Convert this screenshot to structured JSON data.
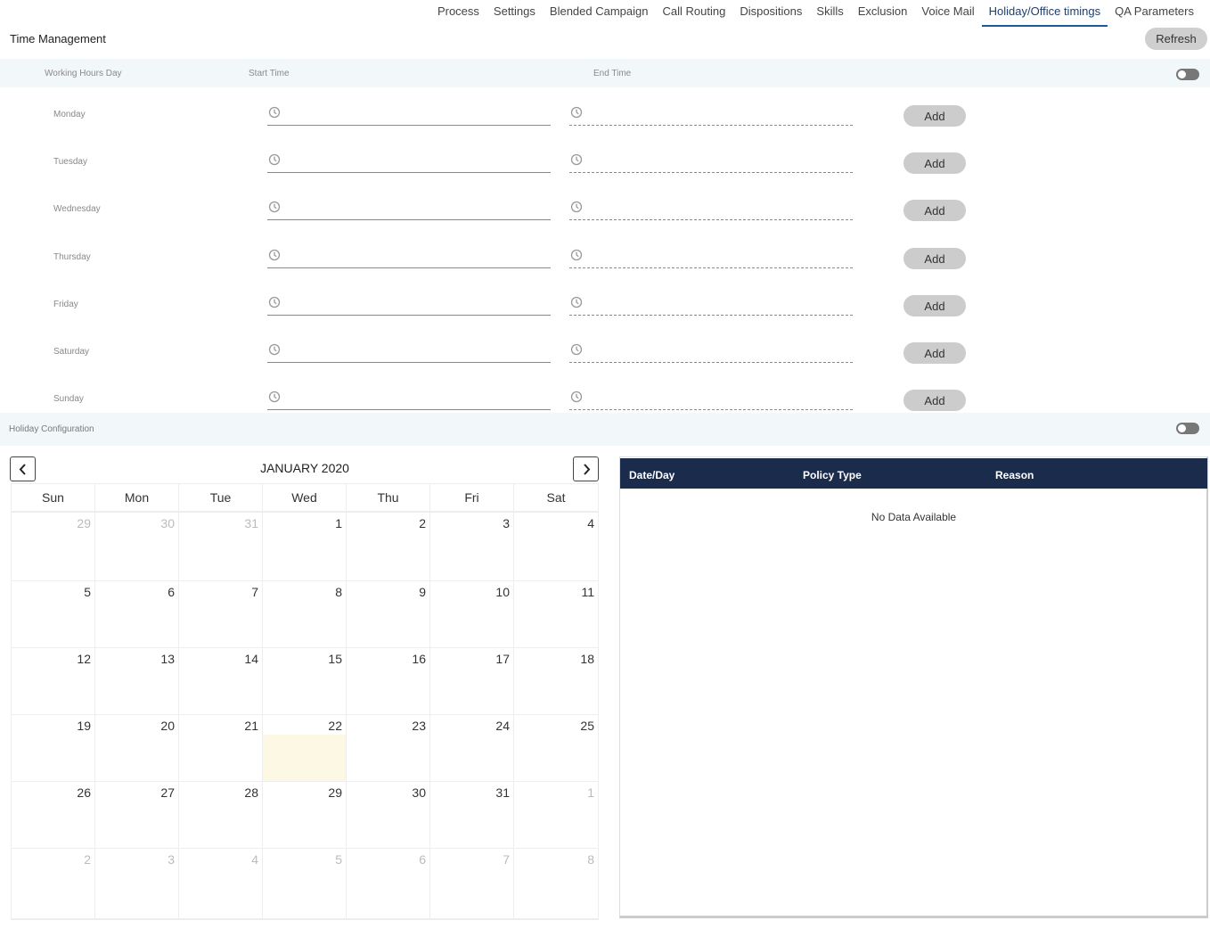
{
  "nav": {
    "tabs": [
      {
        "label": "Process",
        "active": false
      },
      {
        "label": "Settings",
        "active": false
      },
      {
        "label": "Blended Campaign",
        "active": false
      },
      {
        "label": "Call Routing",
        "active": false
      },
      {
        "label": "Dispositions",
        "active": false
      },
      {
        "label": "Skills",
        "active": false
      },
      {
        "label": "Exclusion",
        "active": false
      },
      {
        "label": "Voice Mail",
        "active": false
      },
      {
        "label": "Holiday/Office timings",
        "active": true
      },
      {
        "label": "QA Parameters",
        "active": false
      }
    ]
  },
  "header": {
    "title": "Time Management",
    "refresh_label": "Refresh"
  },
  "working_hours": {
    "col_day": "Working Hours Day",
    "col_start": "Start Time",
    "col_end": "End Time",
    "toggle_on": false,
    "add_label": "Add",
    "days": [
      {
        "name": "Monday",
        "start": "",
        "end": ""
      },
      {
        "name": "Tuesday",
        "start": "",
        "end": ""
      },
      {
        "name": "Wednesday",
        "start": "",
        "end": ""
      },
      {
        "name": "Thursday",
        "start": "",
        "end": ""
      },
      {
        "name": "Friday",
        "start": "",
        "end": ""
      },
      {
        "name": "Saturday",
        "start": "",
        "end": ""
      },
      {
        "name": "Sunday",
        "start": "",
        "end": ""
      }
    ]
  },
  "holiday": {
    "title": "Holiday Configuration",
    "toggle_on": false,
    "calendar": {
      "title": "JANUARY 2020",
      "weekdays": [
        "Sun",
        "Mon",
        "Tue",
        "Wed",
        "Thu",
        "Fri",
        "Sat"
      ],
      "today": 22,
      "weeks": [
        [
          {
            "d": "29",
            "m": true
          },
          {
            "d": "30",
            "m": true
          },
          {
            "d": "31",
            "m": true
          },
          {
            "d": "1"
          },
          {
            "d": "2"
          },
          {
            "d": "3"
          },
          {
            "d": "4"
          }
        ],
        [
          {
            "d": "5"
          },
          {
            "d": "6"
          },
          {
            "d": "7"
          },
          {
            "d": "8"
          },
          {
            "d": "9"
          },
          {
            "d": "10"
          },
          {
            "d": "11"
          }
        ],
        [
          {
            "d": "12"
          },
          {
            "d": "13"
          },
          {
            "d": "14"
          },
          {
            "d": "15"
          },
          {
            "d": "16"
          },
          {
            "d": "17"
          },
          {
            "d": "18"
          }
        ],
        [
          {
            "d": "19"
          },
          {
            "d": "20"
          },
          {
            "d": "21"
          },
          {
            "d": "22",
            "t": true
          },
          {
            "d": "23"
          },
          {
            "d": "24"
          },
          {
            "d": "25"
          }
        ],
        [
          {
            "d": "26"
          },
          {
            "d": "27"
          },
          {
            "d": "28"
          },
          {
            "d": "29"
          },
          {
            "d": "30"
          },
          {
            "d": "31"
          },
          {
            "d": "1",
            "m": true
          }
        ],
        [
          {
            "d": "2",
            "m": true
          },
          {
            "d": "3",
            "m": true
          },
          {
            "d": "4",
            "m": true
          },
          {
            "d": "5",
            "m": true
          },
          {
            "d": "6",
            "m": true
          },
          {
            "d": "7",
            "m": true
          },
          {
            "d": "8",
            "m": true
          }
        ]
      ]
    },
    "table": {
      "columns": [
        "Date/Day",
        "Policy Type",
        "Reason"
      ],
      "empty_text": "No Data Available",
      "rows": []
    }
  },
  "colors": {
    "accent": "#1e5a96",
    "table_header": "#1b2b4b",
    "today_bg": "#fcf8e3",
    "section_bg": "#f2f7f9"
  }
}
